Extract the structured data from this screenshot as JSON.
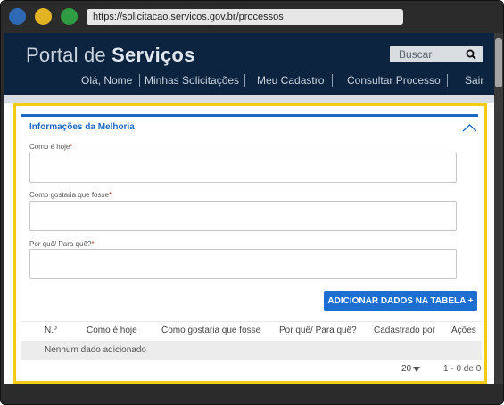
{
  "browser": {
    "url": "https://solicitacao.servicos.gov.br/processos"
  },
  "header": {
    "brand_light": "Portal de ",
    "brand_bold": "Serviços",
    "search_placeholder": "Buscar",
    "nav": [
      "Olá, Nome",
      "Minhas Solicitações",
      "Meu Cadastro",
      "Consultar Processo",
      "Sair"
    ]
  },
  "form": {
    "section_title": "Informações da Melhoria",
    "fields": [
      {
        "label": "Como é hoje",
        "required_mark": "*",
        "value": ""
      },
      {
        "label": "Como gostaria que fosse",
        "required_mark": "*",
        "value": ""
      },
      {
        "label": "Por quê/ Para quê?",
        "required_mark": "*",
        "value": ""
      }
    ],
    "add_button": "ADICIONAR DADOS NA TABELA +"
  },
  "table": {
    "columns": [
      "N.º",
      "Como é hoje",
      "Como gostaria que fosse",
      "Por quê/ Para quê?",
      "Cadastrado por",
      "Ações"
    ],
    "empty_message": "Nenhum dado adicionado",
    "page_size": "20",
    "range": "1 - 0 de 0"
  },
  "colors": {
    "header_bg": "#0d2440",
    "accent": "#1c67c2",
    "highlight_border": "#f3cb13",
    "required": "#c0392b"
  }
}
